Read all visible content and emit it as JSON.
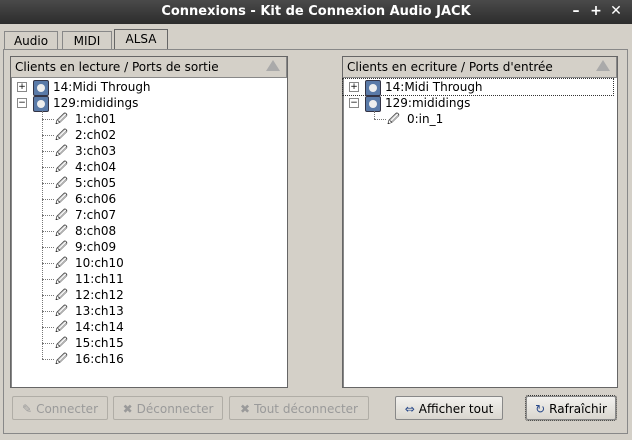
{
  "window": {
    "title": "Connexions - Kit de Connexion Audio JACK",
    "min_label": "–",
    "max_label": "+",
    "close_label": "✕"
  },
  "tabs": [
    {
      "label": "Audio"
    },
    {
      "label": "MIDI"
    },
    {
      "label": "ALSA"
    }
  ],
  "active_tab": "ALSA",
  "left": {
    "header": "Clients en lecture / Ports de sortie",
    "clients": [
      {
        "label": "14:Midi Through",
        "expanded": false
      },
      {
        "label": "129:mididings",
        "expanded": true
      }
    ],
    "ports": [
      "1:ch01",
      "2:ch02",
      "3:ch03",
      "4:ch04",
      "5:ch05",
      "6:ch06",
      "7:ch07",
      "8:ch08",
      "9:ch09",
      "10:ch10",
      "11:ch11",
      "12:ch12",
      "13:ch13",
      "14:ch14",
      "15:ch15",
      "16:ch16"
    ]
  },
  "right": {
    "header": "Clients en ecriture / Ports d'entrée",
    "clients": [
      {
        "label": "14:Midi Through",
        "expanded": false
      },
      {
        "label": "129:mididings",
        "expanded": true
      }
    ],
    "ports": [
      "0:in_1"
    ]
  },
  "buttons": {
    "connect": "Connecter",
    "disconnect": "Déconnecter",
    "disconnect_all": "Tout déconnecter",
    "expand_all": "Afficher tout",
    "refresh": "Rafraîchir"
  }
}
